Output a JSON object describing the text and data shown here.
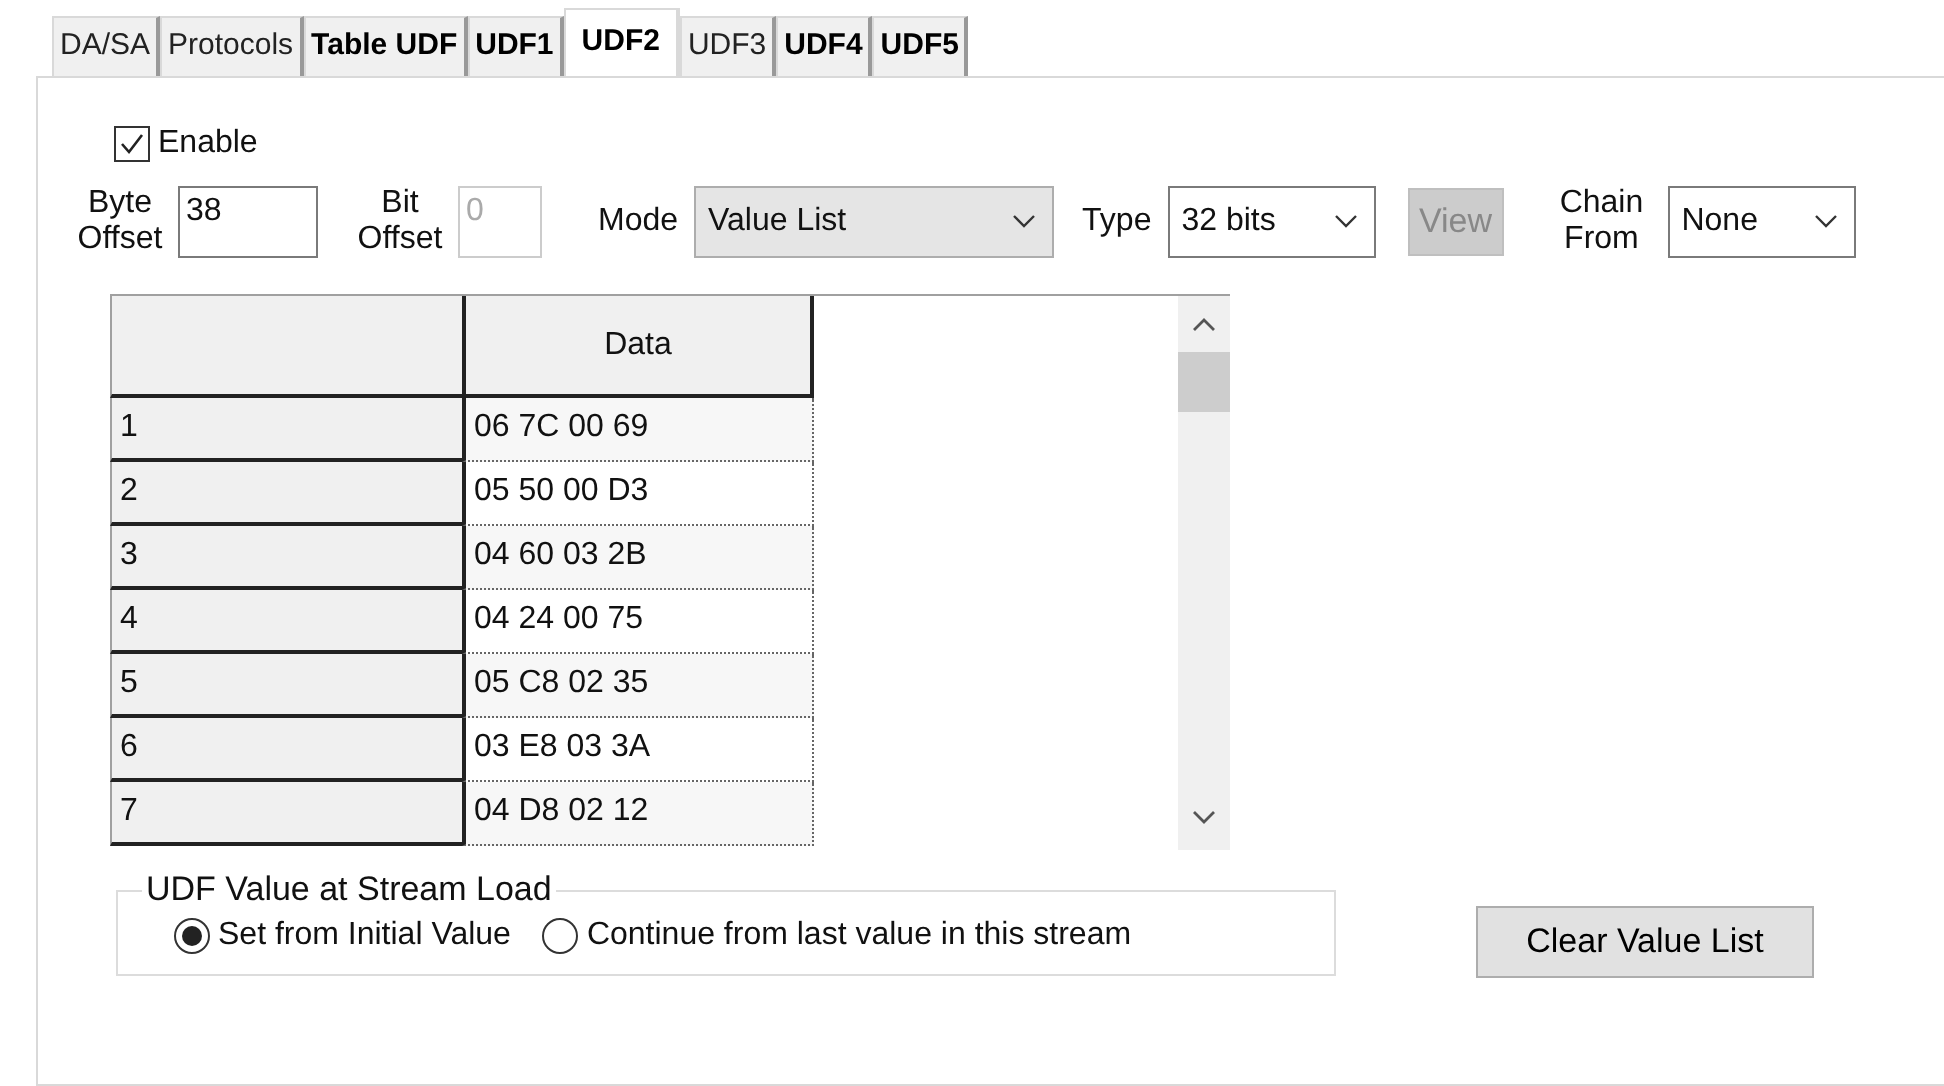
{
  "tabs": [
    {
      "label": "DA/SA",
      "bold": false,
      "selected": false
    },
    {
      "label": "Protocols",
      "bold": false,
      "selected": false
    },
    {
      "label": "Table UDF",
      "bold": true,
      "selected": false
    },
    {
      "label": "UDF1",
      "bold": true,
      "selected": false
    },
    {
      "label": "UDF2",
      "bold": true,
      "selected": true
    },
    {
      "label": "UDF3",
      "bold": false,
      "selected": false
    },
    {
      "label": "UDF4",
      "bold": true,
      "selected": false
    },
    {
      "label": "UDF5",
      "bold": true,
      "selected": false
    }
  ],
  "enable": {
    "label": "Enable",
    "checked": true
  },
  "byte_offset": {
    "label": "Byte Offset",
    "value": "38",
    "disabled": false
  },
  "bit_offset": {
    "label": "Bit Offset",
    "value": "0",
    "disabled": true
  },
  "mode": {
    "label": "Mode",
    "value": "Value List"
  },
  "type": {
    "label": "Type",
    "value": "32 bits"
  },
  "view_button": {
    "label": "View",
    "disabled": true
  },
  "chain_from": {
    "label": "Chain From",
    "value": "None"
  },
  "table": {
    "columns": [
      "Data"
    ],
    "rows": [
      {
        "index": "1",
        "data": "06 7C 00 69"
      },
      {
        "index": "2",
        "data": "05 50 00 D3"
      },
      {
        "index": "3",
        "data": "04 60 03 2B"
      },
      {
        "index": "4",
        "data": "04 24 00 75"
      },
      {
        "index": "5",
        "data": "05 C8 02 35"
      },
      {
        "index": "6",
        "data": "03 E8 03 3A"
      },
      {
        "index": "7",
        "data": "04 D8 02 12"
      }
    ]
  },
  "stream_load": {
    "title": "UDF Value at Stream Load",
    "options": [
      {
        "label": "Set from Initial Value",
        "selected": true
      },
      {
        "label": "Continue from last value in this stream",
        "selected": false
      }
    ]
  },
  "clear_button": {
    "label": "Clear Value List"
  }
}
